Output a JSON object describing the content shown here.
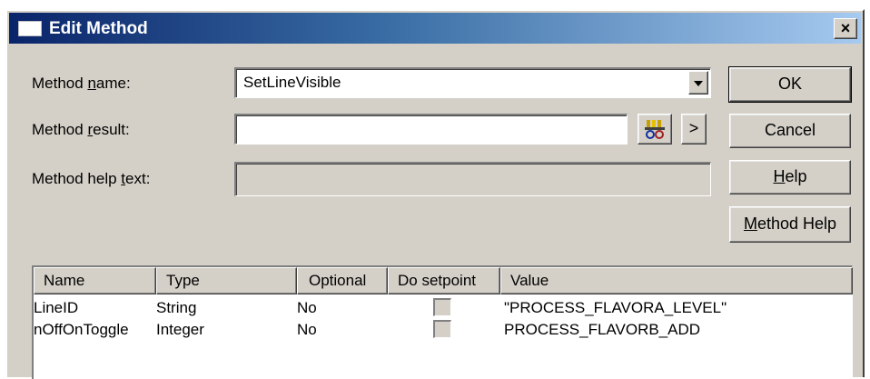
{
  "window": {
    "title": "Edit Method",
    "close_label": "×"
  },
  "form": {
    "method_name": {
      "label_pre": "Method ",
      "label_key": "n",
      "label_post": "ame:",
      "value": "SetLineVisible"
    },
    "method_result": {
      "label_pre": "Method ",
      "label_key": "r",
      "label_post": "esult:",
      "value": "",
      "browse_icon": "tag-browse-icon",
      "more_label": ">"
    },
    "method_help_text": {
      "label_pre": "Method help ",
      "label_key": "t",
      "label_post": "ext:",
      "value": ""
    }
  },
  "buttons": {
    "ok": "OK",
    "cancel": "Cancel",
    "help_key": "H",
    "help_rest": "elp",
    "method_help_key": "M",
    "method_help_rest": "ethod Help"
  },
  "table": {
    "columns": [
      "Name",
      "Type",
      "Optional",
      "Do setpoint",
      "Value"
    ],
    "rows": [
      {
        "name": "LineID",
        "type": "String",
        "optional": "No",
        "do_setpoint": false,
        "value": "\"PROCESS_FLAVORA_LEVEL\""
      },
      {
        "name": "nOffOnToggle",
        "type": "Integer",
        "optional": "No",
        "do_setpoint": false,
        "value": "PROCESS_FLAVORB_ADD"
      }
    ]
  }
}
